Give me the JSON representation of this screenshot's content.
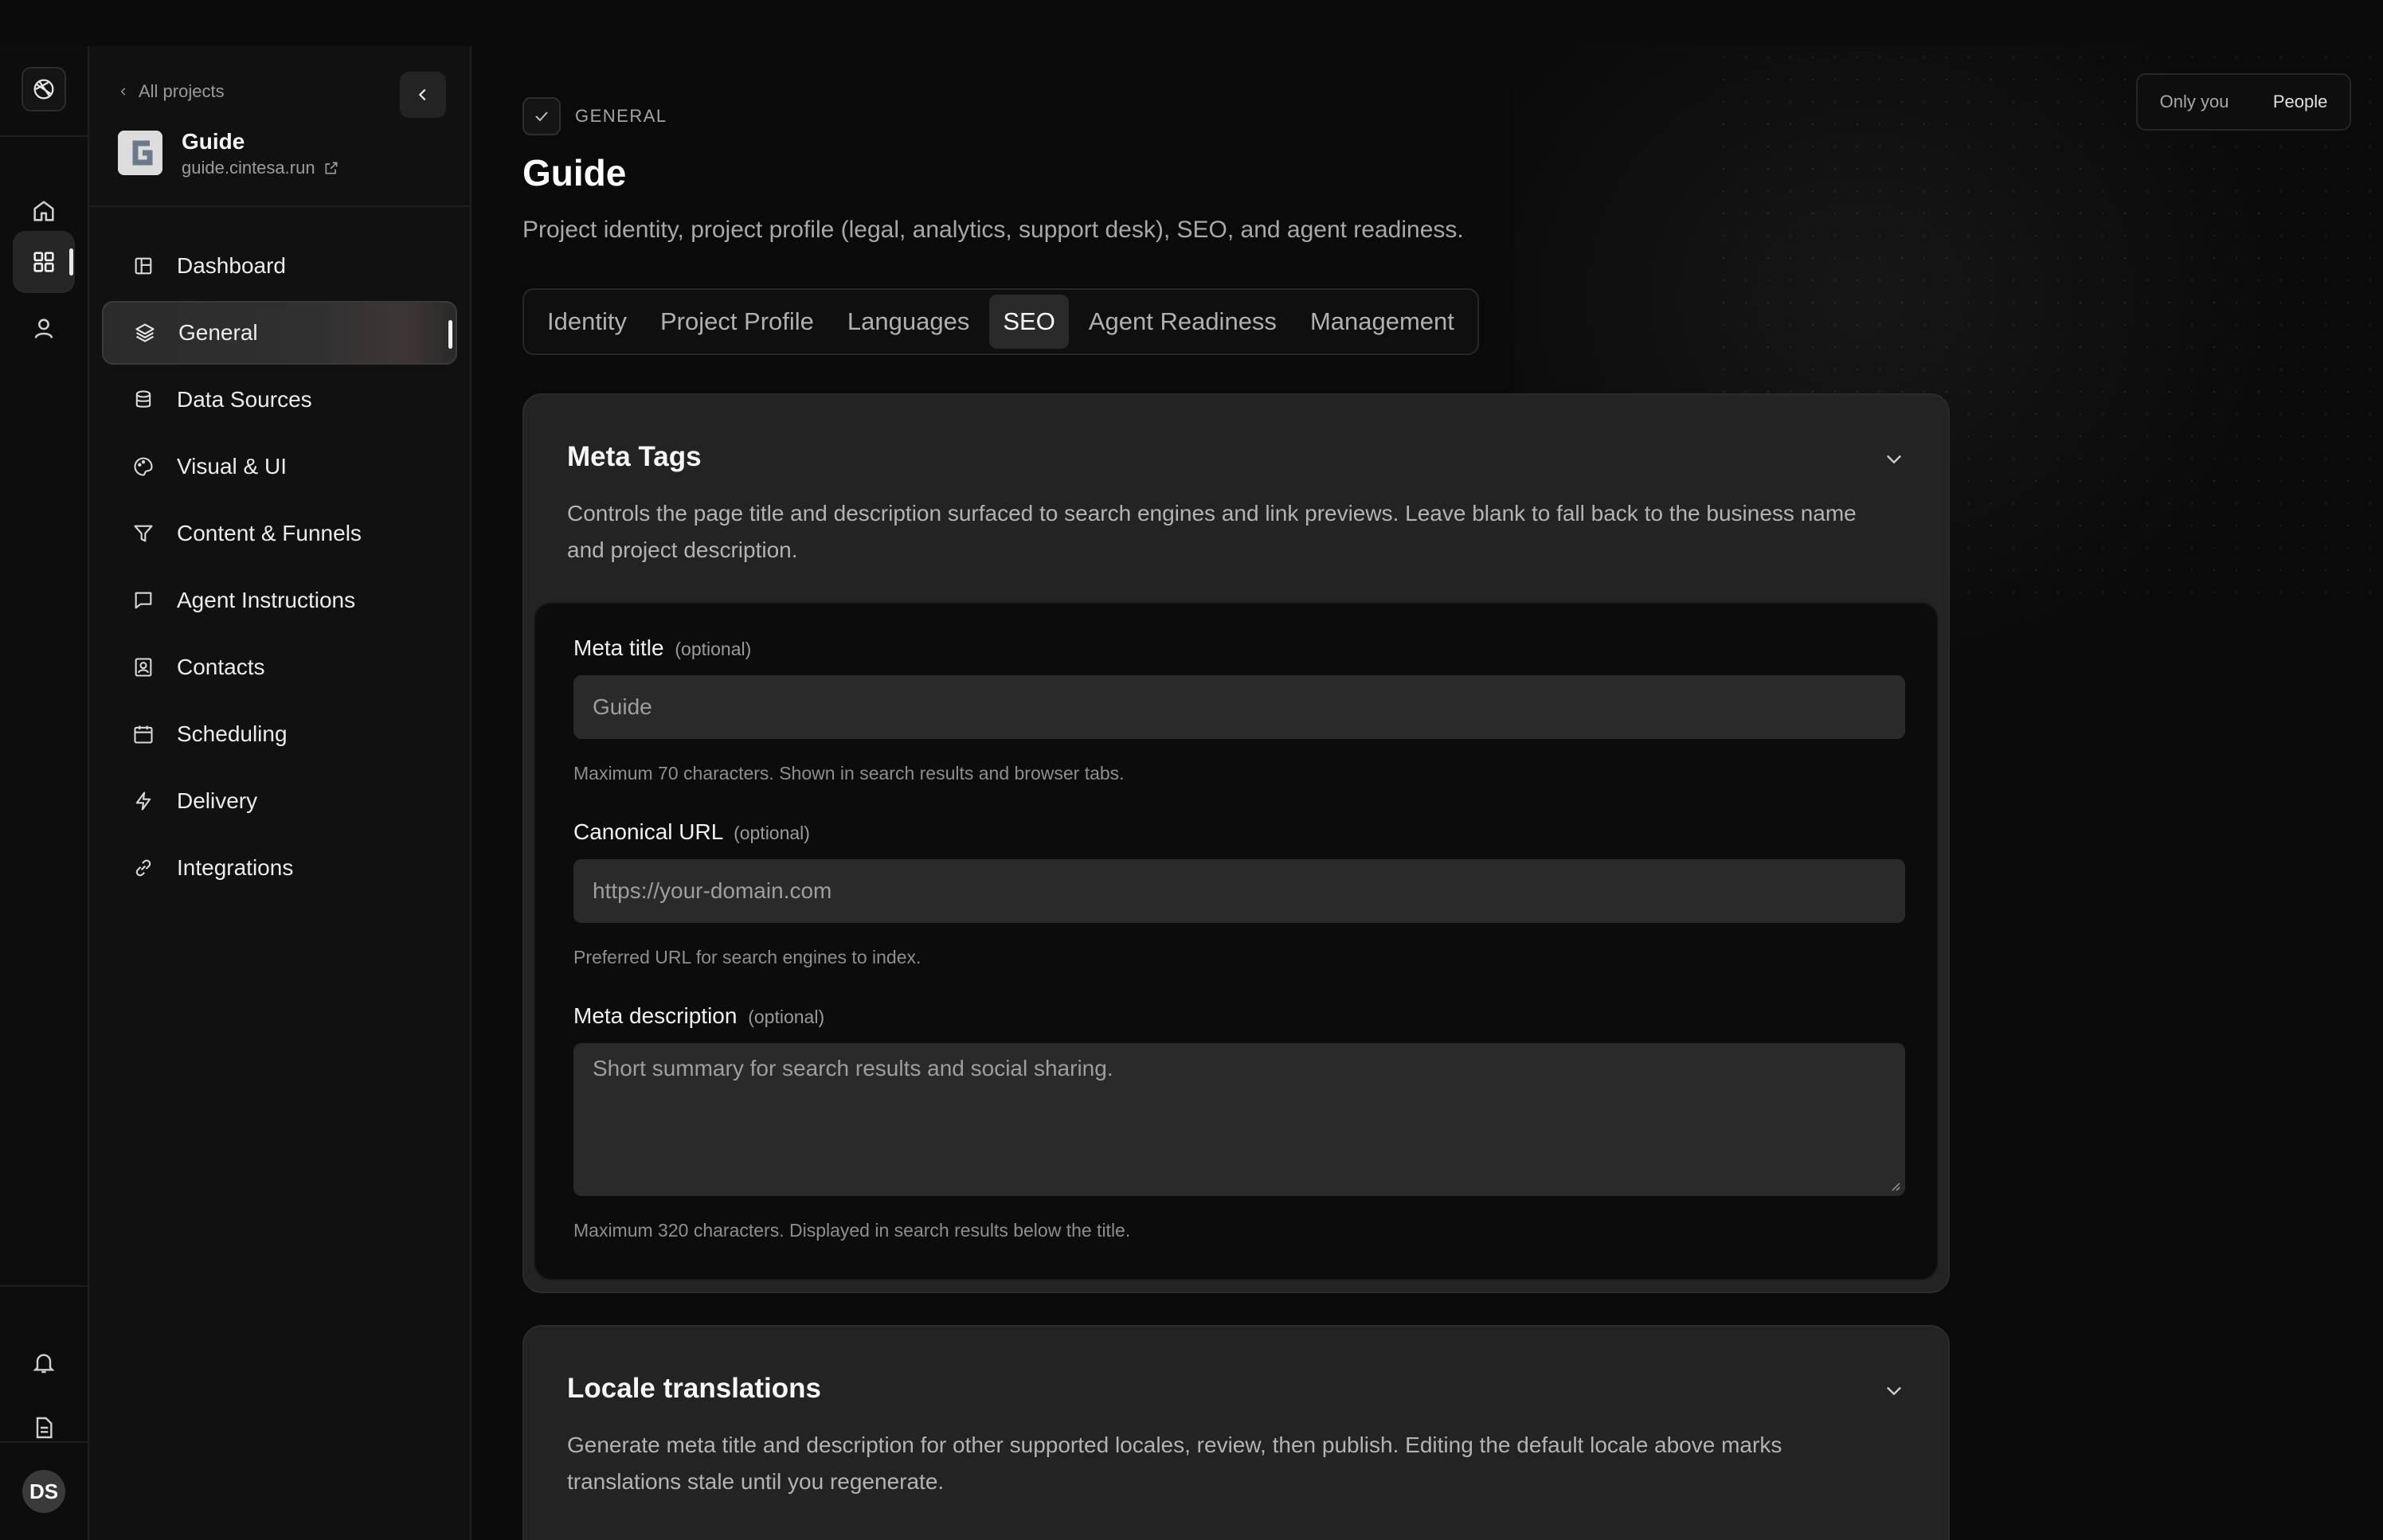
{
  "sidebar": {
    "back_label": "All projects",
    "project_name": "Guide",
    "project_url": "guide.cintesa.run",
    "items": [
      {
        "label": "Dashboard",
        "icon": "dashboard-icon"
      },
      {
        "label": "General",
        "icon": "layers-icon"
      },
      {
        "label": "Data Sources",
        "icon": "database-icon"
      },
      {
        "label": "Visual & UI",
        "icon": "palette-icon"
      },
      {
        "label": "Content & Funnels",
        "icon": "funnel-icon"
      },
      {
        "label": "Agent Instructions",
        "icon": "chat-icon"
      },
      {
        "label": "Contacts",
        "icon": "contact-icon"
      },
      {
        "label": "Scheduling",
        "icon": "calendar-icon"
      },
      {
        "label": "Delivery",
        "icon": "bolt-icon"
      },
      {
        "label": "Integrations",
        "icon": "link-icon"
      }
    ]
  },
  "rail": {
    "avatar_initials": "DS"
  },
  "visibility": {
    "only_you": "Only you",
    "people": "People"
  },
  "header": {
    "section": "GENERAL",
    "title": "Guide",
    "subtitle": "Project identity, project profile (legal, analytics, support desk), SEO, and agent readiness."
  },
  "tabs": [
    "Identity",
    "Project Profile",
    "Languages",
    "SEO",
    "Agent Readiness",
    "Management"
  ],
  "active_tab": "SEO",
  "meta_card": {
    "title": "Meta Tags",
    "description": "Controls the page title and description surfaced to search engines and link previews. Leave blank to fall back to the business name and project description.",
    "fields": {
      "meta_title": {
        "label": "Meta title",
        "optional": "(optional)",
        "placeholder": "Guide",
        "help": "Maximum 70 characters. Shown in search results and browser tabs."
      },
      "canonical_url": {
        "label": "Canonical URL",
        "optional": "(optional)",
        "placeholder": "https://your-domain.com",
        "help": "Preferred URL for search engines to index."
      },
      "meta_description": {
        "label": "Meta description",
        "optional": "(optional)",
        "placeholder": "Short summary for search results and social sharing.",
        "help": "Maximum 320 characters. Displayed in search results below the title."
      }
    }
  },
  "locale_card": {
    "title": "Locale translations",
    "description": "Generate meta title and description for other supported locales, review, then publish. Editing the default locale above marks translations stale until you regenerate."
  }
}
